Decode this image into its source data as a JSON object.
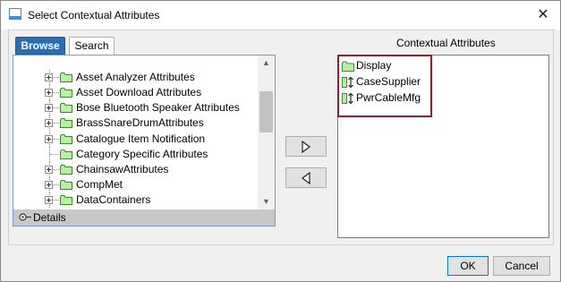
{
  "window": {
    "title": "Select Contextual Attributes",
    "close_symbol": "✕"
  },
  "tabs": [
    {
      "label": "Browse",
      "active": true
    },
    {
      "label": "Search",
      "active": false
    }
  ],
  "tree": {
    "items": [
      {
        "label": "Asset Analyzer Attributes",
        "expandable": true
      },
      {
        "label": "Asset Download Attributes",
        "expandable": true
      },
      {
        "label": "Bose Bluetooth Speaker Attributes",
        "expandable": true
      },
      {
        "label": "BrassSnareDrumAttributes",
        "expandable": true
      },
      {
        "label": "Catalogue Item Notification",
        "expandable": true
      },
      {
        "label": "Category Specific Attributes",
        "expandable": false
      },
      {
        "label": "ChainsawAttributes",
        "expandable": true
      },
      {
        "label": "CompMet",
        "expandable": true
      },
      {
        "label": "DataContainers",
        "expandable": true
      }
    ],
    "scroll_up_symbol": "▲",
    "scroll_down_symbol": "▼"
  },
  "details": {
    "label": "Details"
  },
  "move_buttons": {
    "add_icon": "triangle-right-icon",
    "remove_icon": "triangle-left-icon"
  },
  "contextual": {
    "heading": "Contextual Attributes",
    "items": [
      {
        "label": "Display",
        "icon": "folder-icon"
      },
      {
        "label": "CaseSupplier",
        "icon": "attribute-icon"
      },
      {
        "label": "PwrCableMfg",
        "icon": "attribute-icon"
      }
    ],
    "highlight_color": "#9e1b2b"
  },
  "buttons": {
    "ok": "OK",
    "cancel": "Cancel"
  },
  "colors": {
    "accent": "#2a6db3",
    "folder_fill": "#b8f0a8",
    "folder_stroke": "#3a8a2a"
  }
}
